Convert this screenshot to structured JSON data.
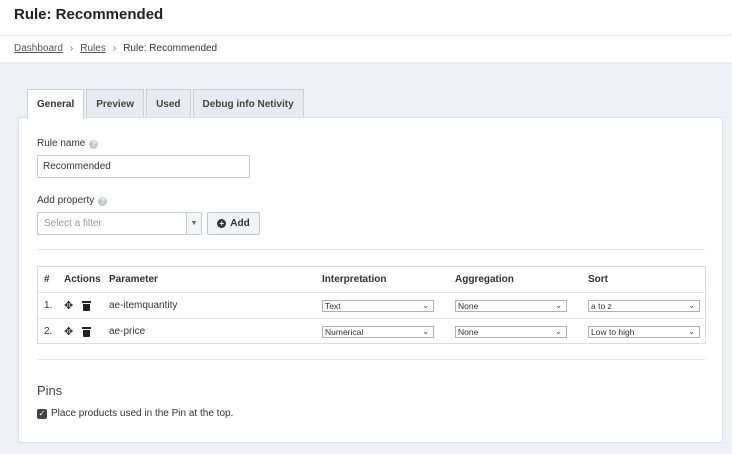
{
  "page": {
    "title": "Rule: Recommended"
  },
  "breadcrumb": {
    "items": [
      {
        "label": "Dashboard"
      },
      {
        "label": "Rules"
      },
      {
        "label": "Rule: Recommended"
      }
    ],
    "separator": "›"
  },
  "tabs": [
    {
      "label": "General",
      "active": true
    },
    {
      "label": "Preview",
      "active": false
    },
    {
      "label": "Used",
      "active": false
    },
    {
      "label": "Debug info Netivity",
      "active": false
    }
  ],
  "form": {
    "rule_name_label": "Rule name",
    "rule_name_value": "Recommended",
    "add_property_label": "Add property",
    "filter_placeholder": "Select a filter",
    "add_button_label": "Add",
    "help_icon": "?"
  },
  "table": {
    "headers": {
      "num": "#",
      "actions": "Actions",
      "parameter": "Parameter",
      "interpretation": "Interpretation",
      "aggregation": "Aggregation",
      "sort": "Sort"
    },
    "rows": [
      {
        "num": "1.",
        "parameter": "ae-itemquantity",
        "interpretation": "Text",
        "aggregation": "None",
        "sort": "a to z"
      },
      {
        "num": "2.",
        "parameter": "ae-price",
        "interpretation": "Numerical",
        "aggregation": "None",
        "sort": "Low to high"
      }
    ]
  },
  "pins": {
    "title": "Pins",
    "checkbox_label": "Place products used in the Pin at the top.",
    "checked": true
  },
  "icons": {
    "move": "move-arrows-icon",
    "delete": "trash-icon",
    "chevron": "chevron-down-icon",
    "plus": "plus-circle-icon"
  }
}
